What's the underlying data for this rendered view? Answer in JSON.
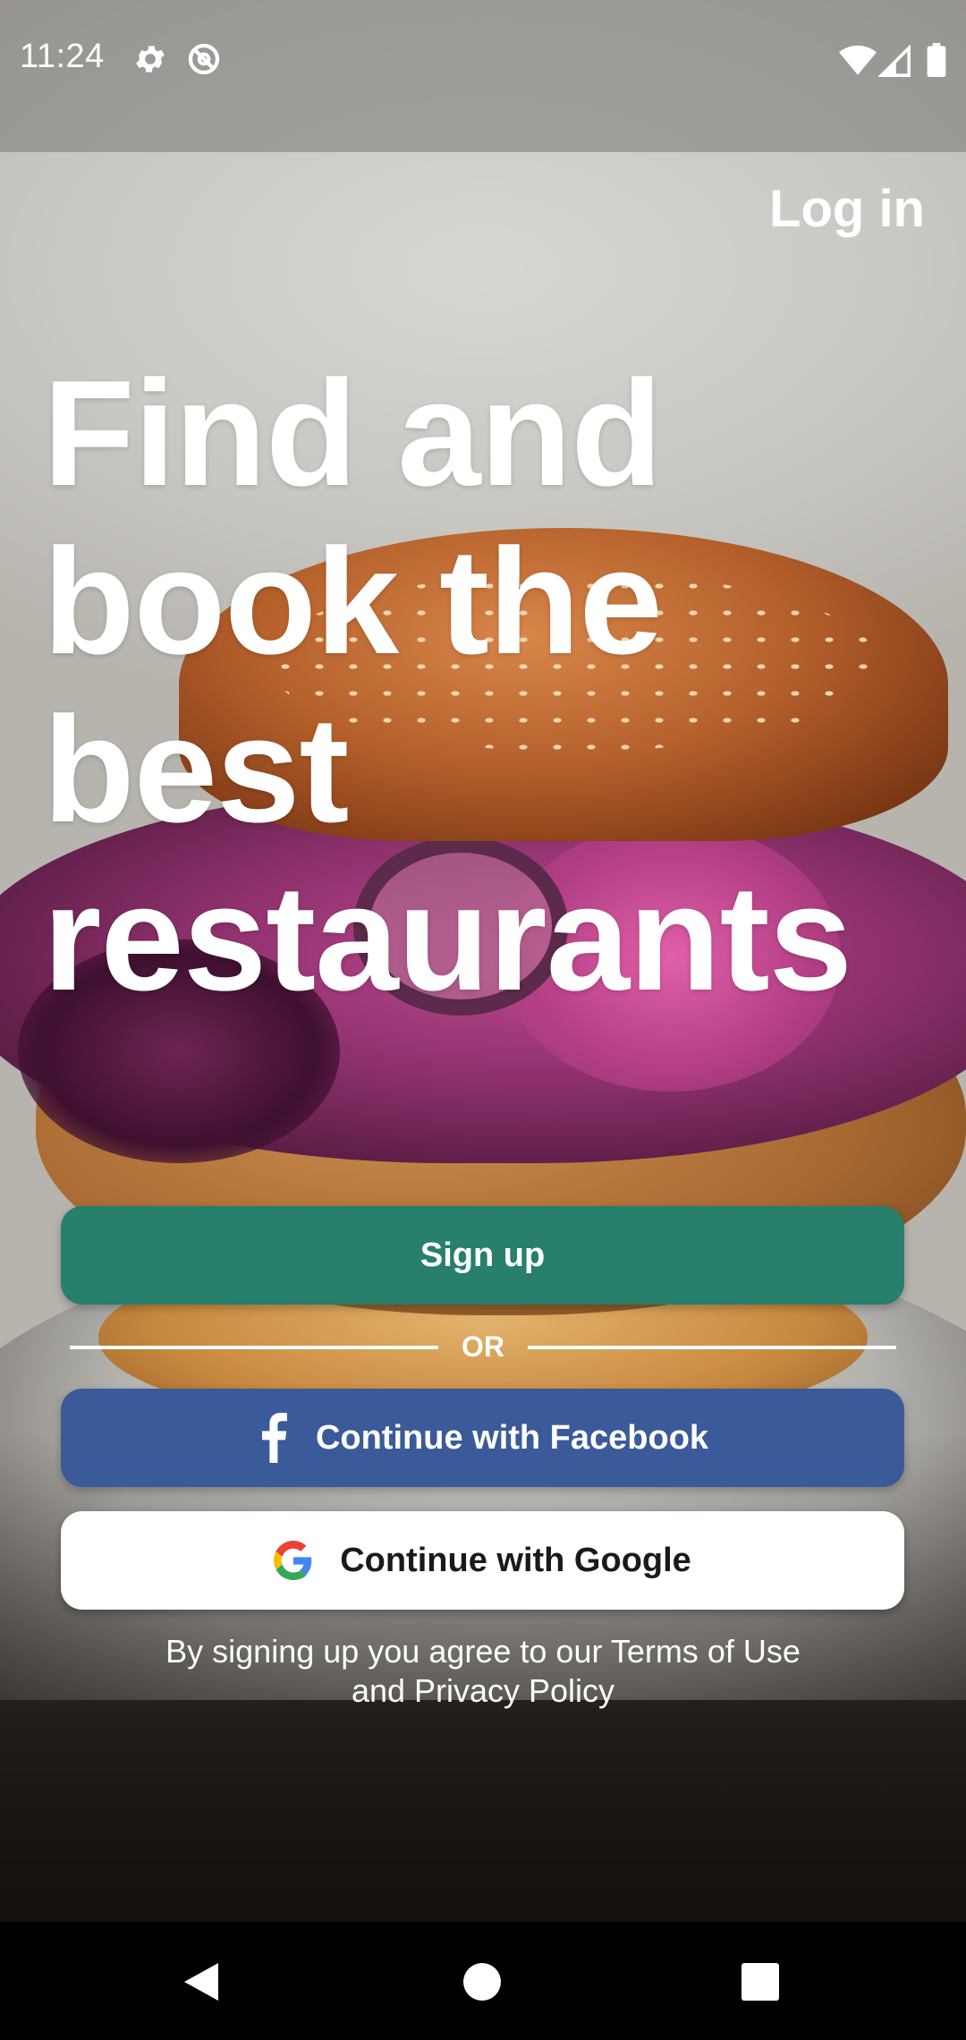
{
  "status_bar": {
    "time": "11:24",
    "left_icons": [
      "gear-icon",
      "do-not-disturb-icon"
    ],
    "right_icons": [
      "wifi-icon",
      "cell-signal-icon",
      "battery-icon"
    ]
  },
  "header": {
    "login_label": "Log in"
  },
  "hero": {
    "headline": "Find and book the best restaurants"
  },
  "actions": {
    "signup_label": "Sign up",
    "divider_label": "OR",
    "facebook_label": "Continue with Facebook",
    "google_label": "Continue with Google"
  },
  "footer": {
    "terms_line1": "By signing up you agree to our Terms of Use",
    "terms_line2": "and Privacy Policy"
  },
  "nav_bar": {
    "buttons": [
      "back-icon",
      "home-icon",
      "recents-icon"
    ]
  },
  "colors": {
    "signup": "#277f6c",
    "facebook": "#3b5a9a",
    "google_bg": "#ffffff"
  }
}
